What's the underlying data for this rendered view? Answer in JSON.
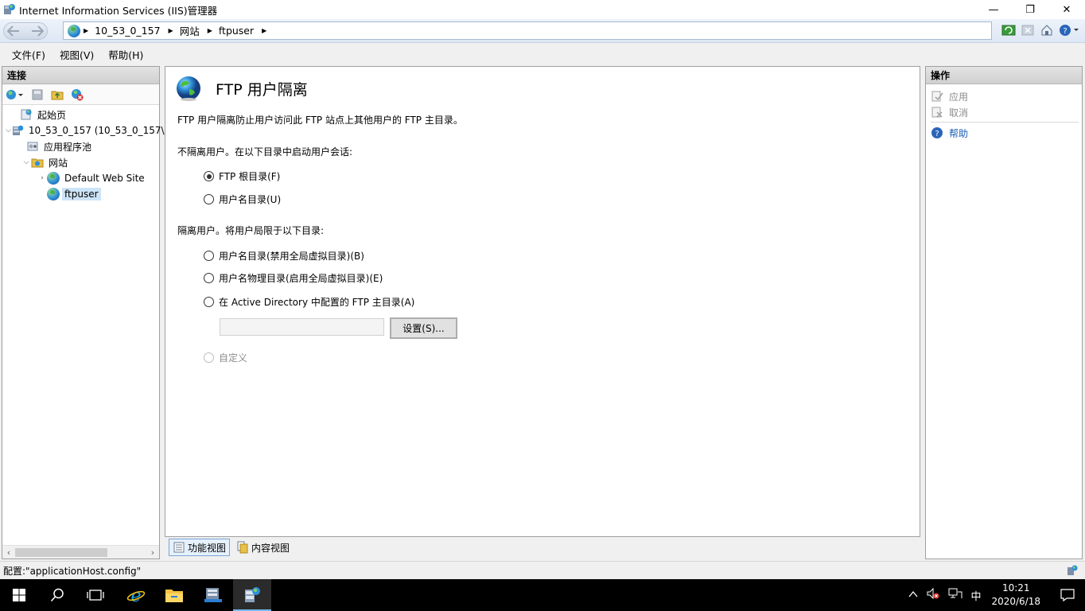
{
  "window": {
    "title": "Internet Information Services (IIS)管理器",
    "minimize": "—",
    "maximize": "❐",
    "close": "✕"
  },
  "address": {
    "crumbs": [
      "10_53_0_157",
      "网站",
      "ftpuser"
    ]
  },
  "menu": {
    "file": "文件(F)",
    "view": "视图(V)",
    "help": "帮助(H)"
  },
  "connections": {
    "header": "连接",
    "tree": {
      "start_page": "起始页",
      "server": "10_53_0_157 (10_53_0_157\\",
      "app_pools": "应用程序池",
      "sites": "网站",
      "default_site": "Default Web Site",
      "ftpuser": "ftpuser"
    }
  },
  "feature": {
    "title": "FTP 用户隔离",
    "description": "FTP 用户隔离防止用户访问此 FTP 站点上其他用户的 FTP 主目录。",
    "no_isolate_label": "不隔离用户。在以下目录中启动用户会话:",
    "opt_ftp_root": "FTP 根目录(F)",
    "opt_username_dir": "用户名目录(U)",
    "isolate_label": "隔离用户。将用户局限于以下目录:",
    "opt_username_dir_disable_global": "用户名目录(禁用全局虚拟目录)(B)",
    "opt_username_physical": "用户名物理目录(启用全局虚拟目录)(E)",
    "opt_active_directory": "在 Active Directory 中配置的 FTP 主目录(A)",
    "ad_input_value": "",
    "settings_button": "设置(S)...",
    "opt_custom": "自定义",
    "selected": "ftp_root"
  },
  "view_tabs": {
    "features": "功能视图",
    "content": "内容视图"
  },
  "actions": {
    "header": "操作",
    "apply": "应用",
    "cancel": "取消",
    "help": "帮助"
  },
  "status": {
    "text": "配置:\"applicationHost.config\""
  },
  "taskbar": {
    "ime": "中",
    "time": "10:21",
    "date": "2020/6/18"
  },
  "colors": {
    "accent": "#1a5fb4",
    "selection": "#cce4f7",
    "taskbar": "#000000"
  }
}
